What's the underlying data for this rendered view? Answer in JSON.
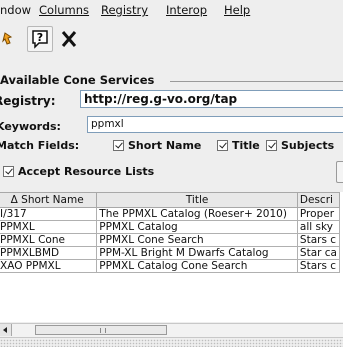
{
  "menu": {
    "window_label": "ndow",
    "columns_label": "Columns",
    "registry_label": "Registry",
    "interop_label": "Interop",
    "help_label": "Help"
  },
  "section": {
    "title": "Available Cone Services"
  },
  "registry": {
    "label": "Registry:",
    "value": "http://reg.g-vo.org/tap"
  },
  "keywords": {
    "label": "Keywords:",
    "value": "ppmxl"
  },
  "match_fields": {
    "label": "Match Fields:",
    "options": [
      "Short Name",
      "Title",
      "Subjects"
    ]
  },
  "accept": {
    "label": "Accept Resource Lists"
  },
  "table": {
    "headers": [
      "Δ Short Name",
      "Title",
      "Descri"
    ],
    "rows": [
      [
        "I/317",
        "The PPMXL Catalog (Roeser+ 2010)",
        "Proper"
      ],
      [
        "PPMXL",
        "PPMXL Catalog",
        "all sky"
      ],
      [
        "PPMXL Cone",
        "PPMXL Cone Search",
        "Stars c"
      ],
      [
        "PPMXLBMD",
        "PPM-XL Bright M Dwarfs Catalog",
        "Star ca"
      ],
      [
        "XAO PPMXL",
        "PPMXL Catalog Cone Search",
        "Stars c"
      ]
    ]
  },
  "colors": {
    "field_border": "#7f9db9",
    "background": "#eeeeee"
  },
  "icons": [
    "wand-icon",
    "help-icon",
    "close-icon"
  ]
}
